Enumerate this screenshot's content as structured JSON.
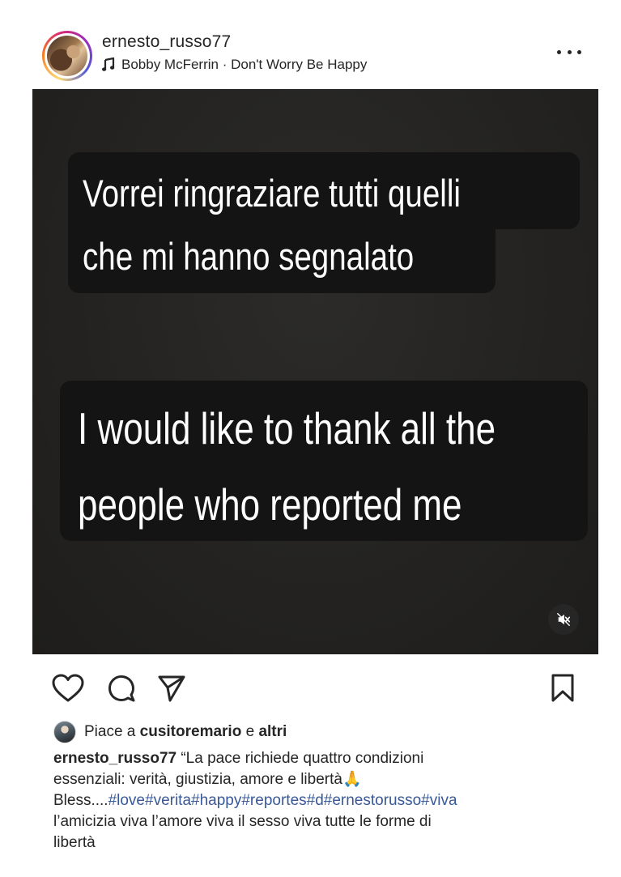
{
  "header": {
    "username": "ernesto_russo77",
    "music": "Bobby McFerrin · Don't Worry Be Happy"
  },
  "media": {
    "italian_line_1": "Vorrei ringraziare tutti quelli",
    "italian_line_2": "che mi hanno segnalato",
    "english_line_1": "I would like to thank all the",
    "english_line_2": "people who reported me"
  },
  "likes": {
    "prefix": "Piace a",
    "user": "cusitoremario",
    "connector": "e",
    "others": "altri"
  },
  "caption": {
    "username": "ernesto_russo77",
    "text_line_1": "“La pace richiede quattro condizioni",
    "text_line_2": "essenziali: verità, giustizia, amore e libertà",
    "emoji": "🙏",
    "bless": "Bless....",
    "hashtags": "#love#verita#happy#reportes#d#ernestorusso#viva",
    "text_line_4": "l’amicizia viva l’amore viva il sesso viva tutte le forme di",
    "text_line_5": "libertà"
  },
  "icons": {
    "more": "more-options-icon",
    "music": "music-note-icon",
    "mute": "muted-speaker-icon",
    "like": "heart-icon",
    "comment": "comment-bubble-icon",
    "share": "paper-plane-icon",
    "save": "bookmark-icon"
  }
}
